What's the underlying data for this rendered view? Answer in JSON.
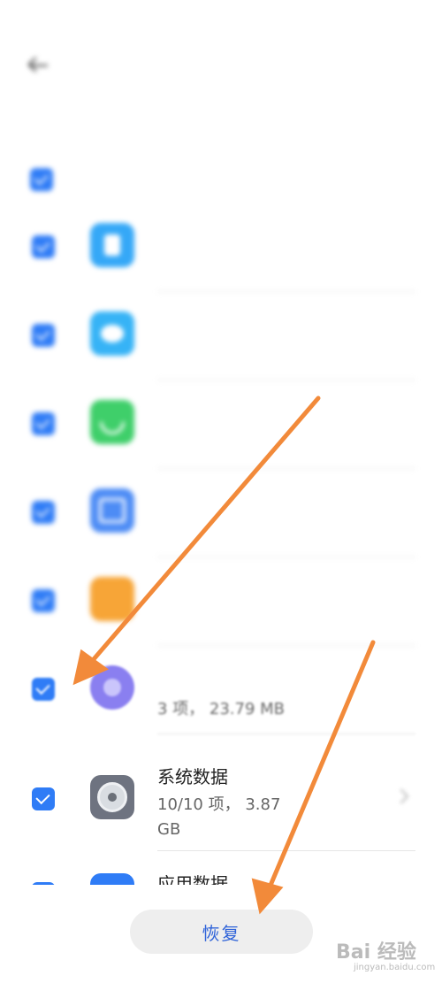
{
  "status_bar": {
    "left": "",
    "right": ""
  },
  "header": {
    "title": ""
  },
  "backup_time": "",
  "select_all": {
    "label": ""
  },
  "items": [
    {
      "name": "",
      "detail": "",
      "icon": "contacts-icon",
      "color": "#35a8f7",
      "checked": true
    },
    {
      "name": "",
      "detail": "",
      "icon": "messages-icon",
      "color": "#36b3f6",
      "checked": true
    },
    {
      "name": "",
      "detail": "",
      "icon": "phone-icon",
      "color": "#3fcf6a",
      "checked": true
    },
    {
      "name": "",
      "detail": "",
      "icon": "calendar-icon",
      "color": "#4d8cf5",
      "checked": true
    },
    {
      "name": "",
      "detail": "",
      "icon": "notes-icon",
      "color": "#f7a537",
      "checked": true
    },
    {
      "name": "",
      "detail": "3 项， 23.79 MB",
      "icon": "music-icon",
      "color": "#8a7ff0",
      "checked": true
    },
    {
      "name": "系统数据",
      "detail": "10/10 项， 3.87\nGB",
      "icon": "settings-gear-icon",
      "color": "#6e7380",
      "checked": true
    },
    {
      "name": "应用数据",
      "detail": "",
      "icon": "app-data-icon",
      "color": "#2f7cf6",
      "checked": true
    }
  ],
  "restore_button": "恢复",
  "watermark": {
    "main": "Bai 经验",
    "sub": "jingyan.baidu.com"
  },
  "colors": {
    "accent": "#2f7cf6",
    "button_text": "#2f63d9",
    "arrow": "#f28a3a"
  }
}
